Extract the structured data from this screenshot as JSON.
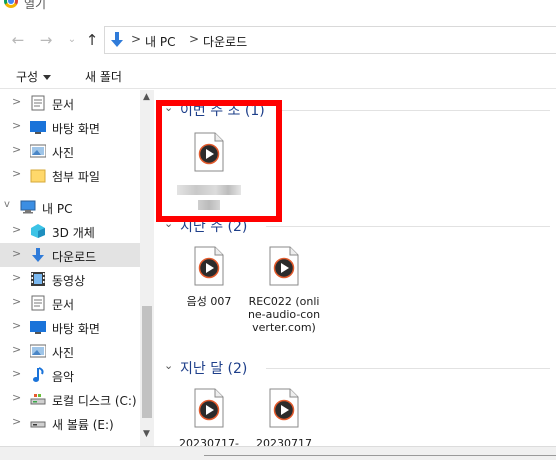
{
  "window": {
    "title": "열기"
  },
  "nav": {
    "back_icon": "arrow-left-icon",
    "forward_icon": "arrow-right-icon",
    "recent_icon": "chevron-down-icon",
    "up_icon": "arrow-up-icon",
    "breadcrumb": [
      "내 PC",
      "다운로드"
    ],
    "separator": ">"
  },
  "toolbar": {
    "organize": "구성",
    "new_folder": "새 폴더"
  },
  "sidebar": {
    "items": [
      {
        "label": "문서",
        "icon": "document-icon"
      },
      {
        "label": "바탕 화면",
        "icon": "desktop-icon"
      },
      {
        "label": "사진",
        "icon": "pictures-icon"
      },
      {
        "label": "첨부 파일",
        "icon": "folder-icon"
      },
      {
        "label": "내 PC",
        "icon": "computer-icon"
      },
      {
        "label": "3D 개체",
        "icon": "3d-objects-icon"
      },
      {
        "label": "다운로드",
        "icon": "download-icon"
      },
      {
        "label": "동영상",
        "icon": "video-icon"
      },
      {
        "label": "문서",
        "icon": "document-icon"
      },
      {
        "label": "바탕 화면",
        "icon": "desktop-icon"
      },
      {
        "label": "사진",
        "icon": "pictures-icon"
      },
      {
        "label": "음악",
        "icon": "music-icon"
      },
      {
        "label": "로컬 디스크 (C:)",
        "icon": "drive-icon"
      },
      {
        "label": "새 볼륨 (E:)",
        "icon": "drive-icon"
      }
    ],
    "expander": ">",
    "expanded": "v"
  },
  "groups": [
    {
      "title": "이번 주 초 (1)",
      "files": [
        {
          "name": ""
        }
      ]
    },
    {
      "title": "지난 주 (2)",
      "files": [
        {
          "name": "음성 007"
        },
        {
          "name": "REC022 (online-audio-converter.com)"
        }
      ]
    },
    {
      "title": "지난 달 (2)",
      "files": [
        {
          "name": "20230717-"
        },
        {
          "name": "20230717"
        }
      ]
    }
  ],
  "colors": {
    "highlight": "#ff0000",
    "group_title": "#1e3f8a",
    "selected_bg": "#e3e3e3"
  }
}
